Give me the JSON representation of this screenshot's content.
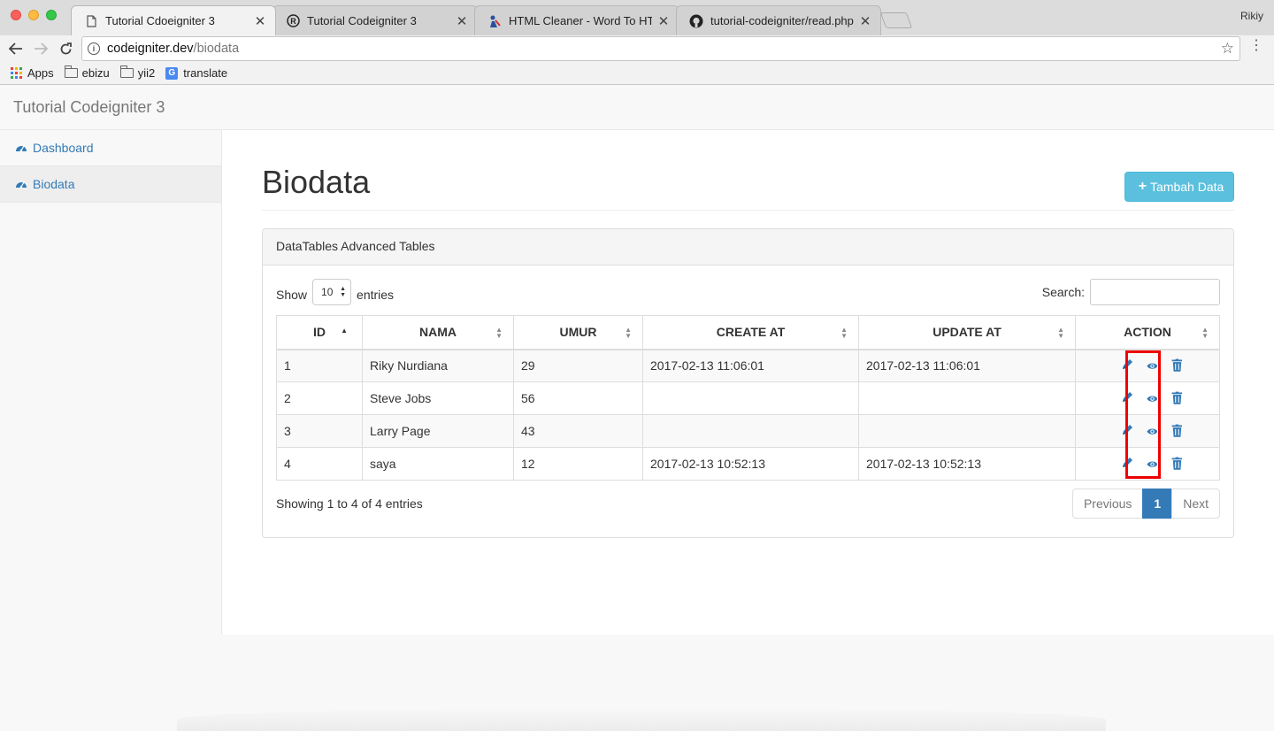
{
  "browser": {
    "tabs": [
      {
        "title": "Tutorial Cdoeigniter 3",
        "active": true,
        "favicon": "page-icon"
      },
      {
        "title": "Tutorial Codeigniter 3",
        "active": false,
        "favicon": "registered-icon"
      },
      {
        "title": "HTML Cleaner - Word To HTM",
        "active": false,
        "favicon": "html-cleaner-icon"
      },
      {
        "title": "tutorial-codeigniter/read.php a",
        "active": false,
        "favicon": "github-icon"
      }
    ],
    "profile_name": "Rikiy",
    "url_host": "codeigniter.dev",
    "url_path": "/biodata",
    "bookmarks": [
      {
        "label": "Apps",
        "icon": "apps-grid-icon"
      },
      {
        "label": "ebizu",
        "icon": "folder-icon"
      },
      {
        "label": "yii2",
        "icon": "folder-icon"
      },
      {
        "label": "translate",
        "icon": "google-translate-icon"
      }
    ]
  },
  "app": {
    "brand": "Tutorial Codeigniter 3",
    "sidebar": [
      {
        "label": "Dashboard",
        "icon": "dashboard-gauge-icon",
        "active": false
      },
      {
        "label": "Biodata",
        "icon": "dashboard-gauge-icon",
        "active": true
      }
    ],
    "page_title": "Biodata",
    "add_button": {
      "icon": "plus",
      "label": "Tambah Data"
    },
    "panel_title": "DataTables Advanced Tables",
    "length_prefix": "Show",
    "length_value": "10",
    "length_suffix": "entries",
    "search_label": "Search:",
    "search_value": "",
    "columns": [
      "ID",
      "NAMA",
      "UMUR",
      "CREATE AT",
      "UPDATE AT",
      "ACTION"
    ],
    "rows": [
      {
        "id": "1",
        "nama": "Riky Nurdiana",
        "umur": "29",
        "create_at": "2017-02-13 11:06:01",
        "update_at": "2017-02-13 11:06:01"
      },
      {
        "id": "2",
        "nama": "Steve Jobs",
        "umur": "56",
        "create_at": "",
        "update_at": ""
      },
      {
        "id": "3",
        "nama": "Larry Page",
        "umur": "43",
        "create_at": "",
        "update_at": ""
      },
      {
        "id": "4",
        "nama": "saya",
        "umur": "12",
        "create_at": "2017-02-13 10:52:13",
        "update_at": "2017-02-13 10:52:13"
      }
    ],
    "info_text": "Showing 1 to 4 of 4 entries",
    "pagination": {
      "previous": "Previous",
      "current": "1",
      "next": "Next"
    },
    "action_icons": [
      "pencil-icon",
      "eye-icon",
      "trash-icon"
    ],
    "colors": {
      "link": "#337ab7",
      "info_button": "#5bc0de",
      "highlight": "#e00000"
    }
  }
}
